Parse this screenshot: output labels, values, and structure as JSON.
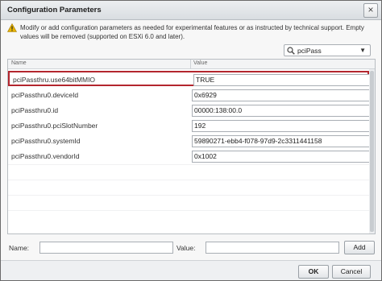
{
  "dialog": {
    "title": "Configuration Parameters",
    "notice": "Modify or add configuration parameters as needed for experimental features or as instructed by technical support. Empty values will be removed (supported on ESXi 6.0 and later).",
    "filter": {
      "value": "pciPass"
    }
  },
  "table": {
    "columns": [
      "Name",
      "Value"
    ],
    "rows": [
      {
        "name": "pciPassthru.use64bitMMIO",
        "value": "TRUE",
        "selected": true
      },
      {
        "name": "pciPassthru0.deviceId",
        "value": "0x6929"
      },
      {
        "name": "pciPassthru0.id",
        "value": "00000:138:00.0"
      },
      {
        "name": "pciPassthru0.pciSlotNumber",
        "value": "192"
      },
      {
        "name": "pciPassthru0.systemId",
        "value": "59890271-ebb4-f078-97d9-2c3311441158"
      },
      {
        "name": "pciPassthru0.vendorId",
        "value": "0x1002"
      }
    ]
  },
  "add_row": {
    "name_label": "Name:",
    "value_label": "Value:",
    "add_label": "Add"
  },
  "footer": {
    "ok_label": "OK",
    "cancel_label": "Cancel"
  },
  "colors": {
    "selection_border": "#b3262e",
    "warning": "#e8b400"
  }
}
